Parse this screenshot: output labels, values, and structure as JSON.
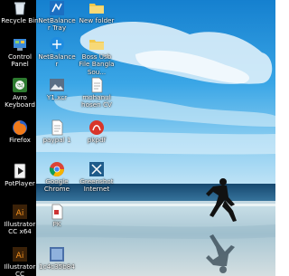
{
  "desktop": {
    "icons": [
      {
        "label": "Recycle Bin",
        "icon": "recycle-bin-icon"
      },
      {
        "label": "Control Panel",
        "icon": "control-panel-icon"
      },
      {
        "label": "Avro Keyboard",
        "icon": "avro-keyboard-icon"
      },
      {
        "label": "Firefox",
        "icon": "firefox-icon"
      },
      {
        "label": "PotPlayer",
        "icon": "potplayer-icon"
      },
      {
        "label": "Illustrator CC x64",
        "icon": "illustrator-icon"
      },
      {
        "label": "Illustrator CC",
        "icon": "illustrator-icon"
      },
      {
        "label": "NetBalancer Tray",
        "icon": "netbalancer-icon"
      },
      {
        "label": "NetBalancer",
        "icon": "netbalancer-icon"
      },
      {
        "label": "Y1.xcr",
        "icon": "image-file-icon"
      },
      {
        "label": "paypal 1",
        "icon": "document-icon"
      },
      {
        "label": "Google Chrome",
        "icon": "chrome-icon"
      },
      {
        "label": "PK",
        "icon": "document-icon"
      },
      {
        "label": "1c4c35b84",
        "icon": "image-file-icon"
      },
      {
        "label": "New folder",
        "icon": "folder-icon"
      },
      {
        "label": "Boss Usb File Bangla Sou...",
        "icon": "folder-icon"
      },
      {
        "label": "mohanul hosen CV",
        "icon": "pdf-file-icon"
      },
      {
        "label": "pkpdf",
        "icon": "pdf-red-icon"
      },
      {
        "label": "Greenshot Internet",
        "icon": "greenshot-icon"
      }
    ]
  },
  "colors": {
    "panel": "#000000",
    "sky_top": "#1a8fd9",
    "sky_mid": "#4db3ec",
    "sea": "#1c4f7a",
    "sand": "#b9cfd7"
  }
}
